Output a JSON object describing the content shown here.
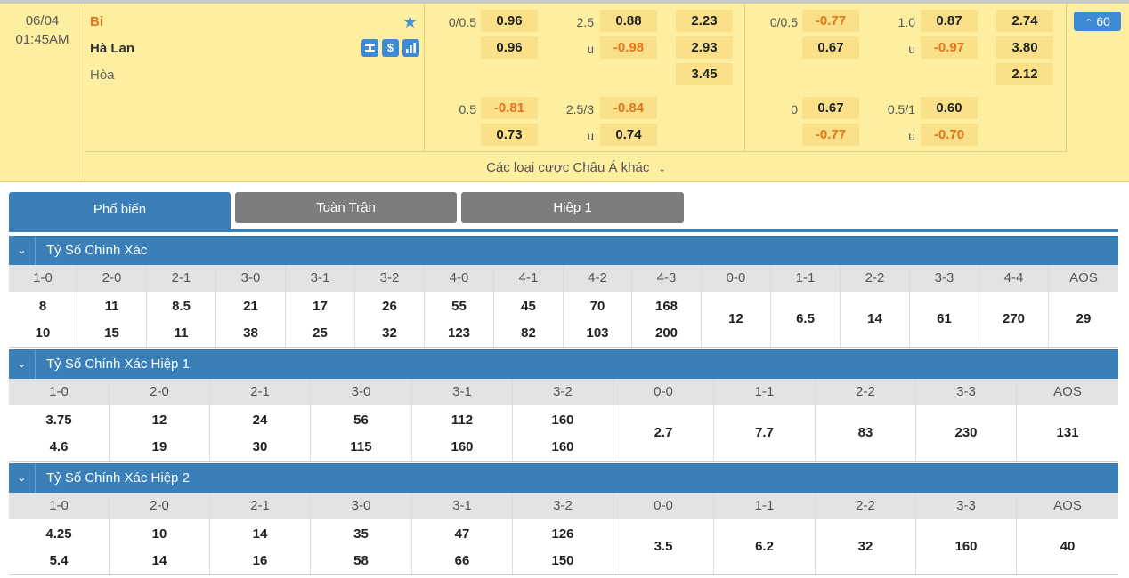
{
  "match": {
    "date": "06/04",
    "time": "01:45AM",
    "home": "Bỉ",
    "away": "Hà Lan",
    "draw": "Hòa",
    "more_count": "60",
    "other_bets": "Các loại cược Châu Á khác",
    "full_time": {
      "handicap_line_1": "0/0.5",
      "handicap_home_1": "0.96",
      "handicap_away_1": "0.96",
      "ou_line_1": "2.5",
      "ou_over_1": "0.88",
      "ou_under_label": "u",
      "ou_under_1": "-0.98",
      "x12_home": "2.23",
      "x12_away": "2.93",
      "x12_draw": "3.45",
      "handicap_line_2": "0.5",
      "handicap_home_2": "-0.81",
      "handicap_away_2": "0.73",
      "ou_line_2": "2.5/3",
      "ou_over_2": "-0.84",
      "ou_under_2": "0.74"
    },
    "first_half": {
      "handicap_line_1": "0/0.5",
      "handicap_home_1": "-0.77",
      "handicap_away_1": "0.67",
      "ou_line_1": "1.0",
      "ou_over_1": "0.87",
      "ou_under_label": "u",
      "ou_under_1": "-0.97",
      "x12_home": "2.74",
      "x12_away": "3.80",
      "x12_draw": "2.12",
      "handicap_line_2": "0",
      "handicap_home_2": "0.67",
      "handicap_away_2": "-0.77",
      "ou_line_2": "0.5/1",
      "ou_over_2": "0.60",
      "ou_under_2": "-0.70"
    }
  },
  "tabs": [
    "Phổ biến",
    "Toàn Trận",
    "Hiệp 1"
  ],
  "sections": [
    {
      "title": "Tỷ Số Chính Xác",
      "headers": [
        "1-0",
        "2-0",
        "2-1",
        "3-0",
        "3-1",
        "3-2",
        "4-0",
        "4-1",
        "4-2",
        "4-3",
        "0-0",
        "1-1",
        "2-2",
        "3-3",
        "4-4",
        "AOS"
      ],
      "values": [
        [
          "8",
          "10"
        ],
        [
          "11",
          "15"
        ],
        [
          "8.5",
          "11"
        ],
        [
          "21",
          "38"
        ],
        [
          "17",
          "25"
        ],
        [
          "26",
          "32"
        ],
        [
          "55",
          "123"
        ],
        [
          "45",
          "82"
        ],
        [
          "70",
          "103"
        ],
        [
          "168",
          "200"
        ],
        [
          "12"
        ],
        [
          "6.5"
        ],
        [
          "14"
        ],
        [
          "61"
        ],
        [
          "270"
        ],
        [
          "29"
        ]
      ]
    },
    {
      "title": "Tỷ Số Chính Xác Hiệp 1",
      "headers": [
        "1-0",
        "2-0",
        "2-1",
        "3-0",
        "3-1",
        "3-2",
        "0-0",
        "1-1",
        "2-2",
        "3-3",
        "AOS"
      ],
      "values": [
        [
          "3.75",
          "4.6"
        ],
        [
          "12",
          "19"
        ],
        [
          "24",
          "30"
        ],
        [
          "56",
          "115"
        ],
        [
          "112",
          "160"
        ],
        [
          "160",
          "160"
        ],
        [
          "2.7"
        ],
        [
          "7.7"
        ],
        [
          "83"
        ],
        [
          "230"
        ],
        [
          "131"
        ]
      ]
    },
    {
      "title": "Tỷ Số Chính Xác Hiệp 2",
      "headers": [
        "1-0",
        "2-0",
        "2-1",
        "3-0",
        "3-1",
        "3-2",
        "0-0",
        "1-1",
        "2-2",
        "3-3",
        "AOS"
      ],
      "values": [
        [
          "4.25",
          "5.4"
        ],
        [
          "10",
          "14"
        ],
        [
          "14",
          "16"
        ],
        [
          "35",
          "58"
        ],
        [
          "47",
          "66"
        ],
        [
          "126",
          "150"
        ],
        [
          "3.5"
        ],
        [
          "6.2"
        ],
        [
          "32"
        ],
        [
          "160"
        ],
        [
          "40"
        ]
      ]
    }
  ],
  "colors": {
    "accent": "#3a7fb8",
    "negative": "#e4731d",
    "match_bg": "#fdeea0"
  }
}
